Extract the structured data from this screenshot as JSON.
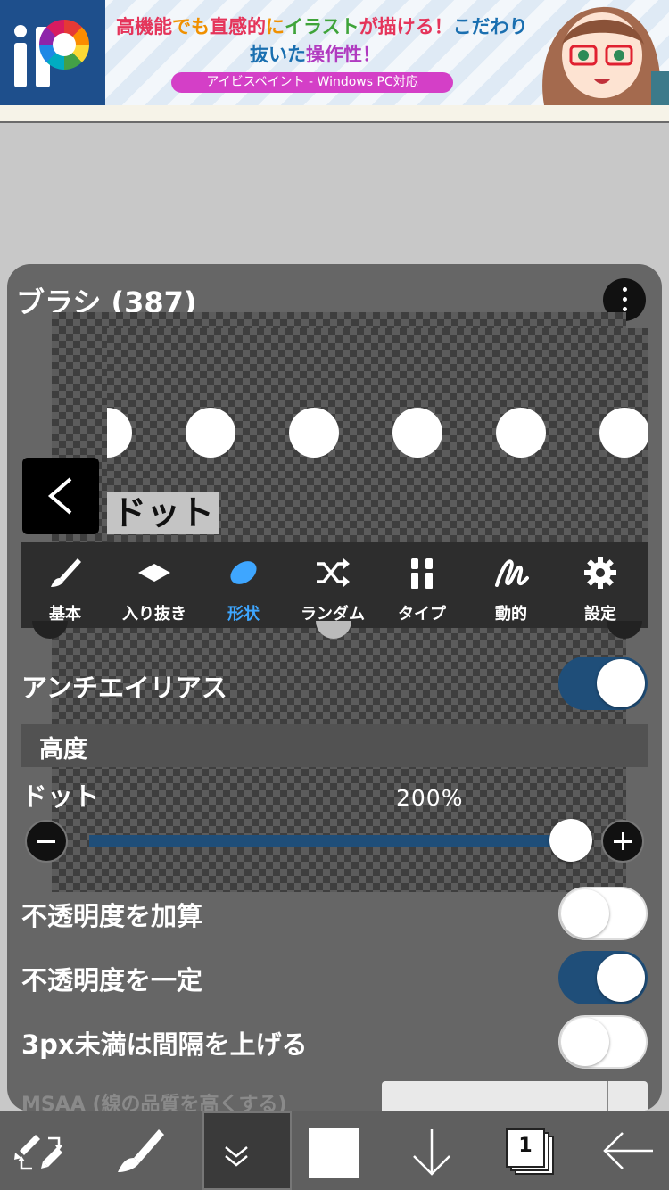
{
  "ad": {
    "line1": [
      "高機能",
      "で",
      "も",
      "直感的",
      "に",
      "イラスト",
      "が描ける！",
      "こだわり"
    ],
    "line2": [
      "抜いた",
      "操作性",
      "！"
    ],
    "pill": "アイビスペイント - Windows PC対応"
  },
  "panel": {
    "title": "ブラシ (387)",
    "brush_name": "ドット"
  },
  "tabs": [
    {
      "label": "基本",
      "icon": "brush-icon"
    },
    {
      "label": "入り抜き",
      "icon": "diamond-icon"
    },
    {
      "label": "形状",
      "icon": "ellipse-icon",
      "active": true
    },
    {
      "label": "ランダム",
      "icon": "shuffle-icon"
    },
    {
      "label": "タイプ",
      "icon": "brush-types-icon"
    },
    {
      "label": "動的",
      "icon": "scribble-icon"
    },
    {
      "label": "設定",
      "icon": "gear-icon"
    }
  ],
  "settings": {
    "antialias": {
      "label": "アンチエイリアス",
      "on": true
    },
    "section_height": "高度",
    "dot": {
      "label": "ドット",
      "value": "200%",
      "fraction": 1.0
    },
    "opacity_add": {
      "label": "不透明度を加算",
      "on": false
    },
    "opacity_const": {
      "label": "不透明度を一定",
      "on": true
    },
    "spacing": {
      "label": "3px未満は間隔を上げる",
      "on": false
    },
    "cut_row": "MSAA (線の品質を高くする)"
  },
  "toolbar": {
    "items": [
      "transform-tool-icon",
      "brush-tool-icon",
      "collapse-chevrons-icon",
      "color-swatch-icon",
      "down-arrow-icon",
      "layers-icon",
      "back-arrow-icon"
    ],
    "layer_count": "1",
    "color": "#ffffff"
  },
  "colors": {
    "accent_blue": "#3ea6ff",
    "toggle_on": "#1f4e79",
    "panel_bg": "#666666"
  }
}
